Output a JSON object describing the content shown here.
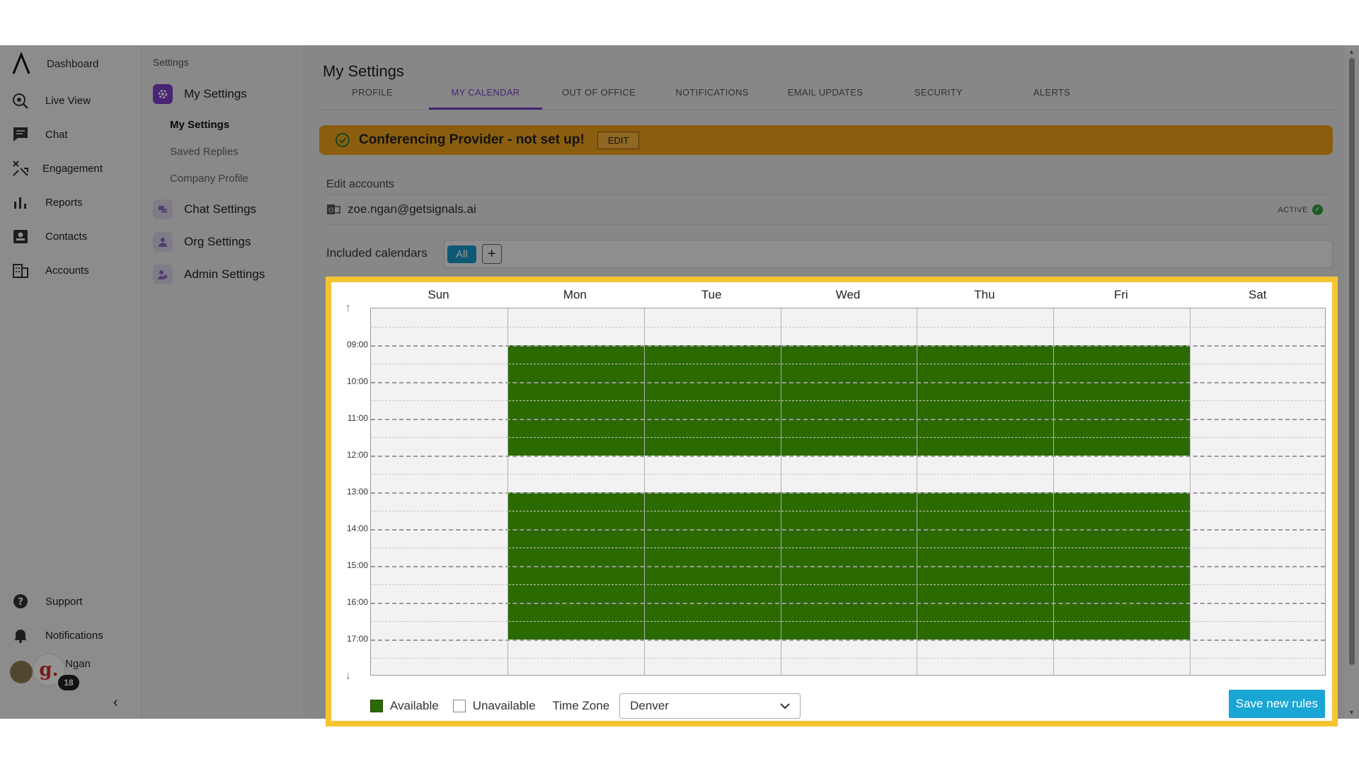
{
  "nav": {
    "items": [
      {
        "label": "Dashboard",
        "icon": "logo-icon"
      },
      {
        "label": "Live View",
        "icon": "live-view-icon"
      },
      {
        "label": "Chat",
        "icon": "chat-icon"
      },
      {
        "label": "Engagement",
        "icon": "engagement-icon"
      },
      {
        "label": "Reports",
        "icon": "bar-chart-icon"
      },
      {
        "label": "Contacts",
        "icon": "contacts-icon"
      },
      {
        "label": "Accounts",
        "icon": "building-icon"
      }
    ],
    "support": "Support",
    "notifications": "Notifications",
    "user": {
      "name": "Ngan",
      "initial": "g.",
      "badge": "18"
    },
    "collapse": "‹"
  },
  "settings_menu": {
    "title": "Settings",
    "groups": [
      "My Settings",
      "Chat Settings",
      "Org Settings",
      "Admin Settings"
    ],
    "links": [
      "My Settings",
      "Saved Replies",
      "Company Profile"
    ]
  },
  "main": {
    "title": "My Settings",
    "tabs": [
      "PROFILE",
      "MY CALENDAR",
      "OUT OF OFFICE",
      "NOTIFICATIONS",
      "EMAIL UPDATES",
      "SECURITY",
      "ALERTS"
    ],
    "active_tab": "MY CALENDAR",
    "banner": {
      "text": "Conferencing Provider - not set up!",
      "button": "EDIT",
      "color": "#f0a21b"
    },
    "edit_accounts": "Edit accounts",
    "account": {
      "email": "zoe.ngan@getsignals.ai",
      "status": "ACTIVE"
    },
    "included_calendars": {
      "label": "Included calendars",
      "chip": "All",
      "add": "+"
    }
  },
  "calendar": {
    "days": [
      "Sun",
      "Mon",
      "Tue",
      "Wed",
      "Thu",
      "Fri",
      "Sat"
    ],
    "hours": [
      "09:00",
      "10:00",
      "11:00",
      "12:00",
      "13:00",
      "14:00",
      "15:00",
      "16:00",
      "17:00"
    ],
    "available_color": "#2a6a00",
    "availability": [
      {
        "days": [
          "Mon",
          "Tue",
          "Wed",
          "Thu",
          "Fri"
        ],
        "start": "09:00",
        "end": "12:00"
      },
      {
        "days": [
          "Mon",
          "Tue",
          "Wed",
          "Thu",
          "Fri"
        ],
        "start": "13:00",
        "end": "17:00"
      }
    ],
    "legend": {
      "available": "Available",
      "unavailable": "Unavailable"
    },
    "timezone": {
      "label": "Time Zone",
      "value": "Denver"
    },
    "save_button": "Save new rules"
  }
}
